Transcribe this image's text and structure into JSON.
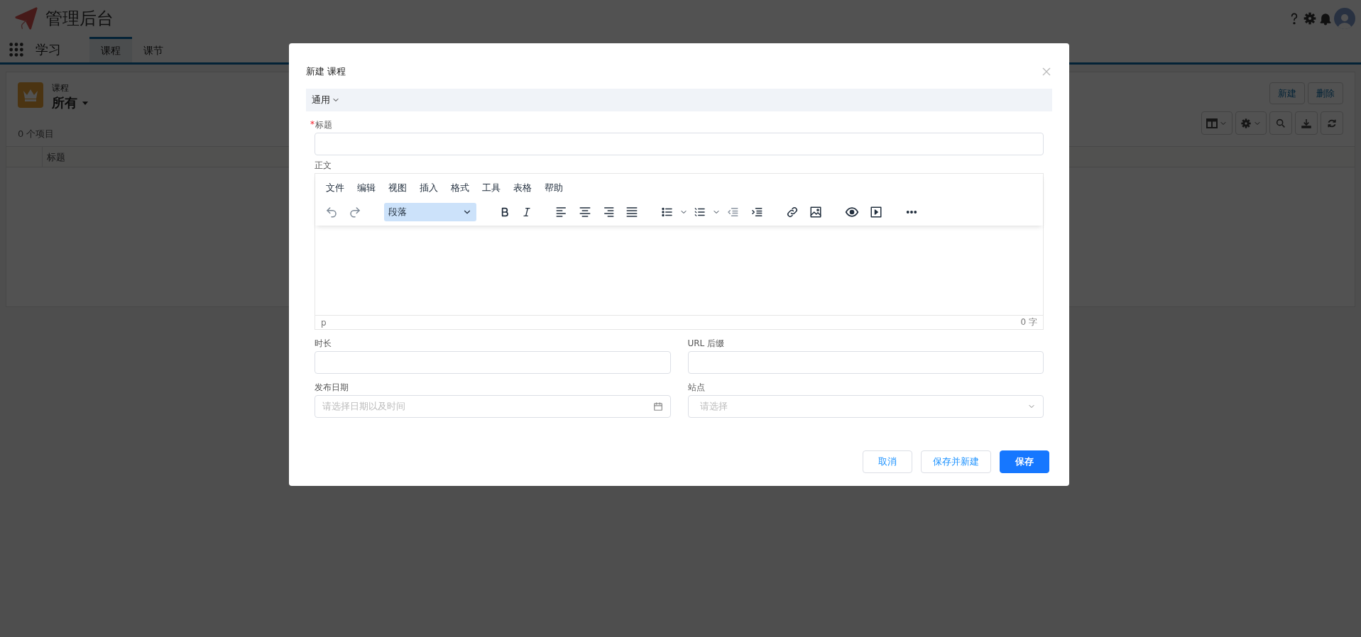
{
  "app": {
    "title": "管理后台"
  },
  "nav": {
    "app_name": "学习",
    "tabs": [
      {
        "label": "课程",
        "selected": true
      },
      {
        "label": "课节",
        "selected": false
      }
    ]
  },
  "list": {
    "object": "课程",
    "view": "所有",
    "count": "0 个项目",
    "buttons": [
      "新建",
      "删除"
    ],
    "columns": [
      "标题"
    ]
  },
  "modal": {
    "title": "新建 课程",
    "section": {
      "label": "通用",
      "expanded": true
    },
    "title_field": {
      "label": "标题",
      "required_mark": "*"
    },
    "editor": {
      "label": "正文",
      "menus": [
        "文件",
        "编辑",
        "视图",
        "插入",
        "格式",
        "工具",
        "表格",
        "帮助"
      ],
      "format": "段落",
      "path": "p",
      "word_count": "0 字"
    },
    "fields": [
      {
        "label": "时长",
        "kind": "text"
      },
      {
        "label": "URL 后缀",
        "kind": "text"
      },
      {
        "label": "发布日期",
        "kind": "date",
        "placeholder": "请选择日期以及时间"
      },
      {
        "label": "站点",
        "kind": "select",
        "placeholder": "请选择"
      }
    ],
    "buttons": [
      {
        "label": "取消",
        "kind": "default"
      },
      {
        "label": "保存并新建",
        "kind": "default"
      },
      {
        "label": "保存",
        "kind": "primary"
      }
    ]
  }
}
